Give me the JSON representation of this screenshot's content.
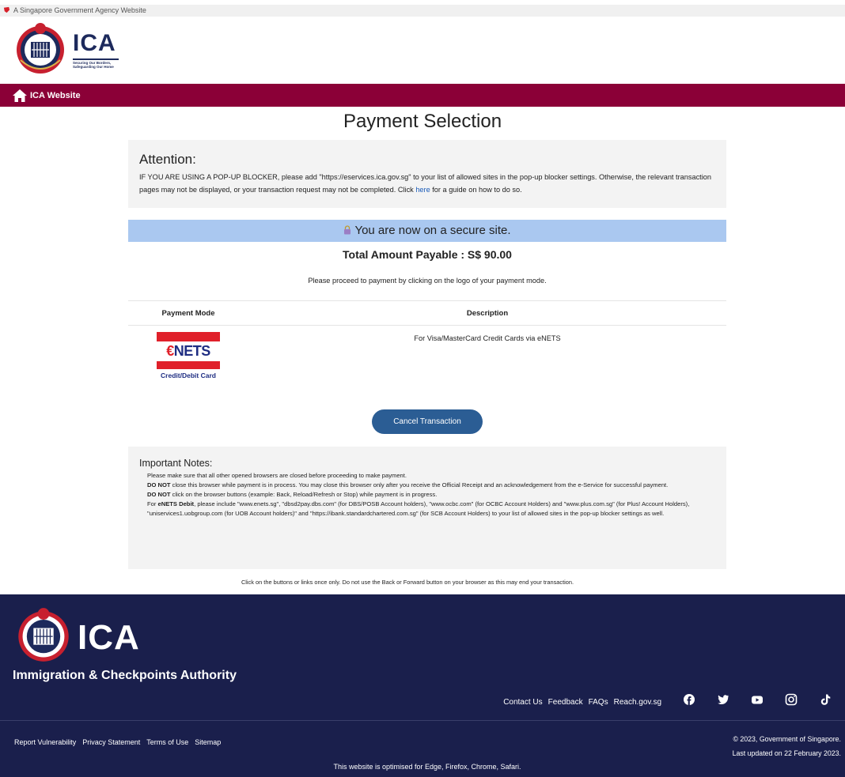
{
  "gov_banner": {
    "text": "A Singapore Government Agency Website"
  },
  "header": {
    "logo_text": "ICA",
    "tagline_line1": "Securing Our Borders,",
    "tagline_line2": "Safeguarding Our Home"
  },
  "nav": {
    "home_label": "ICA Website"
  },
  "page": {
    "title": "Payment Selection"
  },
  "attention": {
    "heading": "Attention:",
    "text_before": "IF YOU ARE USING A POP-UP BLOCKER, please add \"https://eservices.ica.gov.sg\" to your list of allowed sites in the pop-up blocker settings. Otherwise, the relevant transaction pages may not be displayed, or your transaction request may not be completed. Click ",
    "link": "here",
    "text_after": " for a guide on how to do so."
  },
  "secure": {
    "text": "You are now on a secure site."
  },
  "payment": {
    "total": "Total Amount Payable : S$ 90.00",
    "instruction": "Please proceed to payment by clicking on the logo of your payment mode.",
    "columns": [
      "Payment Mode",
      "Description"
    ],
    "rows": [
      {
        "logo_text_e": "€",
        "logo_text_rest": "NETS",
        "logo_caption": "Credit/Debit Card",
        "description": "For Visa/MasterCard Credit Cards via eNETS"
      }
    ],
    "cancel_label": "Cancel Transaction"
  },
  "notes": {
    "heading": "Important Notes:",
    "line1": "Please make sure that all other opened browsers are closed before proceeding to make payment.",
    "line2_bold": "DO NOT",
    "line2": " close this browser while payment is in process. You may close this browser only after you receive the Official Receipt and an acknowledgement from the e-Service for successful payment.",
    "line3_bold": "DO NOT",
    "line3": " click on the browser buttons (example: Back, Reload/Refresh or Stop) while payment is in progress.",
    "line4_pre": "For ",
    "line4_bold": "eNETS Debit",
    "line4": ", please include \"www.enets.sg\", \"dbsd2pay.dbs.com\" (for DBS/POSB Account holders), \"www.ocbc.com\" (for OCBC Account Holders) and \"www.plus.com.sg\" (for Plus! Account Holders), \"uniservices1.uobgroup.com (for UOB Account holders)\" and \"https://ibank.standardchartered.com.sg\" (for SCB Account Holders) to your list of allowed sites in the pop-up blocker settings as well."
  },
  "click_note": "Click on the buttons or links once only. Do not use the Back or Forward button on your browser as this may end your transaction.",
  "footer": {
    "logo_text": "ICA",
    "org_name": "Immigration & Checkpoints Authority",
    "links": [
      "Contact Us",
      "Feedback",
      "FAQs",
      "Reach.gov.sg"
    ],
    "socials": [
      "facebook-icon",
      "twitter-icon",
      "youtube-icon",
      "instagram-icon",
      "tiktok-icon"
    ],
    "legal": [
      "Report Vulnerability",
      "Privacy Statement",
      "Terms of Use",
      "Sitemap"
    ],
    "copyright": "© 2023, Government of Singapore.",
    "updated": "Last updated on 22 February 2023.",
    "optimised": "This website is optimised for Edge, Firefox, Chrome, Safari."
  },
  "colors": {
    "nav_maroon": "#8b0037",
    "secure_blue": "#aac8f0",
    "button_blue": "#2b5d94",
    "footer_navy": "#1a1f4c",
    "enets_red": "#e0202a"
  }
}
